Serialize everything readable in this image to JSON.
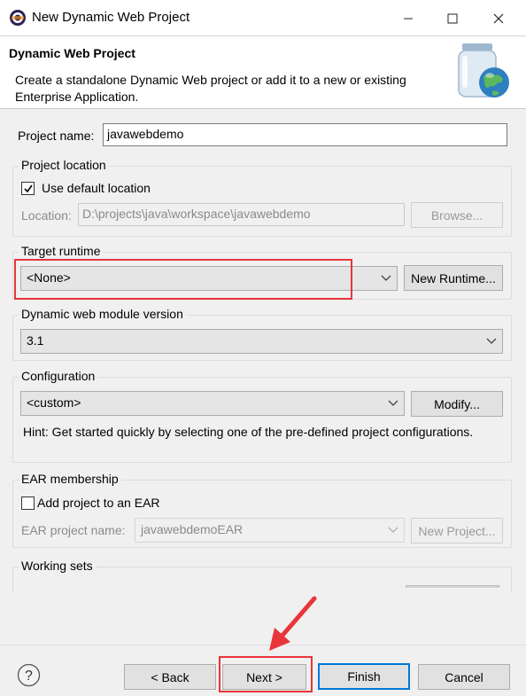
{
  "window": {
    "title": "New Dynamic Web Project",
    "minimize_icon": "minimize-icon",
    "maximize_icon": "maximize-icon",
    "close_icon": "close-icon"
  },
  "header": {
    "title": "Dynamic Web Project",
    "description": "Create a standalone Dynamic Web project or add it to a new or existing Enterprise Application.",
    "graphic_icon": "web-jar-globe-icon"
  },
  "project_name": {
    "label": "Project name:",
    "value": "javawebdemo"
  },
  "project_location": {
    "title": "Project location",
    "use_default_label": "Use default location",
    "use_default_checked": true,
    "location_label": "Location:",
    "location_value": "D:\\projects\\java\\workspace\\javawebdemo",
    "browse_label": "Browse..."
  },
  "target_runtime": {
    "title": "Target runtime",
    "selected": "<None>",
    "new_runtime_label": "New Runtime..."
  },
  "web_module": {
    "title": "Dynamic web module version",
    "selected": "3.1"
  },
  "configuration": {
    "title": "Configuration",
    "selected": "<custom>",
    "modify_label": "Modify...",
    "hint": "Hint: Get started quickly by selecting one of the pre-defined project configurations."
  },
  "ear": {
    "title": "EAR membership",
    "add_label": "Add project to an EAR",
    "add_checked": false,
    "name_label": "EAR project name:",
    "name_value": "javawebdemoEAR",
    "new_project_label": "New Project..."
  },
  "working_sets": {
    "title": "Working sets"
  },
  "footer": {
    "help_icon": "help-icon",
    "back_label": "< Back",
    "next_label": "Next >",
    "finish_label": "Finish",
    "cancel_label": "Cancel"
  },
  "annotation": {
    "highlight_color": "#e8353a",
    "arrow_icon": "red-arrow-icon"
  }
}
